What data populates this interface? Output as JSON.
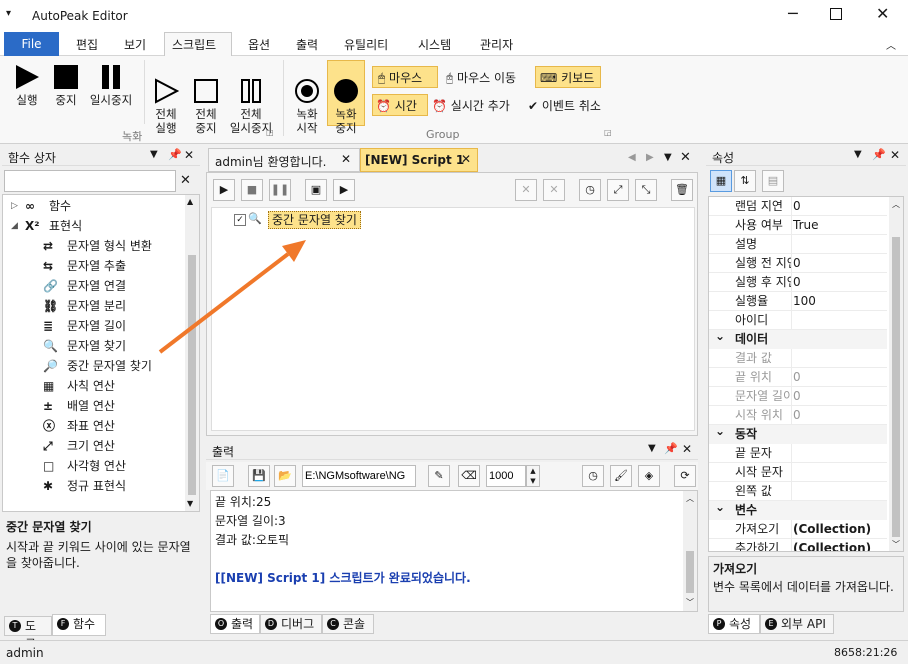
{
  "app": {
    "title": "AutoPeak Editor",
    "status_user": "admin",
    "status_time": "8658:21:26"
  },
  "menu": {
    "file": "File",
    "tabs": [
      "편집",
      "보기",
      "스크립트",
      "옵션",
      "출력",
      "유틸리티",
      "시스템",
      "관리자"
    ]
  },
  "ribbon": {
    "buttons": {
      "run": "실행",
      "stop": "중지",
      "pause": "일시중지",
      "run_all": "전체\n실행",
      "stop_all": "전체\n중지",
      "pause_all": "전체\n일시중지",
      "rec_start": "녹화\n시작",
      "rec_stop": "녹화\n중지"
    },
    "group_record": "녹화",
    "mouse": "마우스",
    "mouse_move": "마우스 이동",
    "keyboard": "키보드",
    "time": "시간",
    "realtime_add": "실시간 추가",
    "event_cancel": "이벤트 취소",
    "group_name": "Group"
  },
  "functions": {
    "title": "함수 상자",
    "tree": [
      {
        "label": "함수",
        "level": 0,
        "icon": "infinity-icon"
      },
      {
        "label": "표현식",
        "level": 0,
        "icon": "x-squared-icon"
      },
      {
        "label": "문자열 형식 변환",
        "level": 1,
        "icon": "convert-icon"
      },
      {
        "label": "문자열 추출",
        "level": 1,
        "icon": "extract-icon"
      },
      {
        "label": "문자열 연결",
        "level": 1,
        "icon": "link-icon"
      },
      {
        "label": "문자열 분리",
        "level": 1,
        "icon": "unlink-icon"
      },
      {
        "label": "문자열 길이",
        "level": 1,
        "icon": "list-icon"
      },
      {
        "label": "문자열 찾기",
        "level": 1,
        "icon": "search-icon"
      },
      {
        "label": "중간 문자열 찾기",
        "level": 1,
        "icon": "zoom-icon"
      },
      {
        "label": "사칙 연산",
        "level": 1,
        "icon": "calculator-icon"
      },
      {
        "label": "배열 연산",
        "level": 1,
        "icon": "plus-minus-icon"
      },
      {
        "label": "좌표 연산",
        "level": 1,
        "icon": "xy-icon"
      },
      {
        "label": "크기 연산",
        "level": 1,
        "icon": "resize-icon"
      },
      {
        "label": "사각형 연산",
        "level": 1,
        "icon": "square-icon"
      },
      {
        "label": "정규 표현식",
        "level": 1,
        "icon": "asterisk-icon"
      }
    ],
    "desc_title": "중간 문자열 찾기",
    "desc_text": "시작과 끝 키워드 사이에 있는 문자열을 찾아줍니다.",
    "bottom_tabs": [
      "도구",
      "함수"
    ]
  },
  "editor": {
    "tabs": [
      "admin님 환영합니다.",
      "[NEW] Script 1"
    ],
    "node": "중간 문자열 찾기"
  },
  "output": {
    "title": "출력",
    "path": "E:\\NGMsoftware\\NG",
    "count": "1000",
    "lines": [
      "끝 위치:25",
      "문자열 길이:3",
      "결과 값:오토픽",
      "",
      "[[NEW] Script 1] 스크립트가 완료되었습니다."
    ],
    "bottom_tabs": [
      "출력",
      "디버그",
      "콘솔"
    ]
  },
  "properties": {
    "title": "속성",
    "rows": [
      {
        "type": "row",
        "k": "랜덤 지연",
        "v": "0"
      },
      {
        "type": "row",
        "k": "사용 여부",
        "v": "True"
      },
      {
        "type": "row",
        "k": "설명",
        "v": ""
      },
      {
        "type": "row",
        "k": "실행 전 지연",
        "v": "0"
      },
      {
        "type": "row",
        "k": "실행 후 지연",
        "v": "0"
      },
      {
        "type": "row",
        "k": "실행율",
        "v": "100"
      },
      {
        "type": "row",
        "k": "아이디",
        "v": ""
      },
      {
        "type": "cat",
        "k": "데이터"
      },
      {
        "type": "dim",
        "k": "결과 값",
        "v": ""
      },
      {
        "type": "dim",
        "k": "끝 위치",
        "v": "0"
      },
      {
        "type": "dim",
        "k": "문자열 길이",
        "v": "0"
      },
      {
        "type": "dim",
        "k": "시작 위치",
        "v": "0"
      },
      {
        "type": "cat",
        "k": "동작"
      },
      {
        "type": "row",
        "k": "끝 문자",
        "v": ""
      },
      {
        "type": "row",
        "k": "시작 문자",
        "v": ""
      },
      {
        "type": "row",
        "k": "왼쪽 값",
        "v": ""
      },
      {
        "type": "cat",
        "k": "변수"
      },
      {
        "type": "row",
        "k": "가져오기",
        "v": "(Collection)",
        "bold": true
      },
      {
        "type": "row",
        "k": "추가하기",
        "v": "(Collection)",
        "bold": true
      }
    ],
    "desc_title": "가져오기",
    "desc_text": "변수 목록에서 데이터를 가져옵니다.",
    "bottom_tabs": [
      "속성",
      "외부 API"
    ]
  }
}
